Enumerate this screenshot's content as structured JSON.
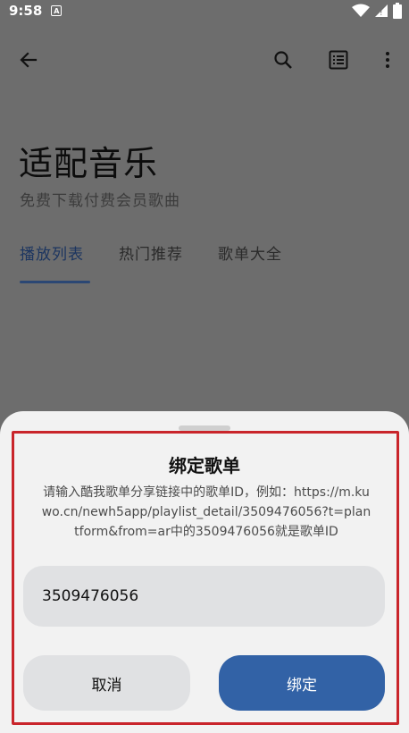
{
  "status_bar": {
    "time": "9:58",
    "notification_badge": "A"
  },
  "app_bar": {
    "icons": [
      "back-icon",
      "search-icon",
      "list-icon",
      "more-icon"
    ]
  },
  "header": {
    "title": "适配音乐",
    "subtitle": "免费下载付费会员歌曲"
  },
  "tabs": [
    {
      "label": "播放列表",
      "active": true
    },
    {
      "label": "热门推荐",
      "active": false
    },
    {
      "label": "歌单大全",
      "active": false
    }
  ],
  "dialog": {
    "title": "绑定歌单",
    "description": "请输入酷我歌单分享链接中的歌单ID，例如：https://m.kuwo.cn/newh5app/playlist_detail/3509476056?t=plantform&from=ar中的3509476056就是歌单ID",
    "input_value": "3509476056",
    "cancel_label": "取消",
    "confirm_label": "绑定"
  },
  "colors": {
    "accent": "#3262a6",
    "highlight": "#c9252b",
    "scrim": "#6d6d6d"
  }
}
